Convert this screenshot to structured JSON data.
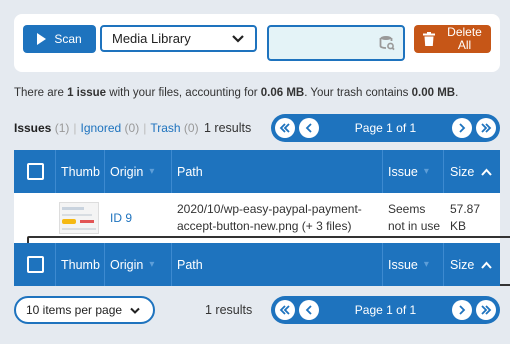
{
  "toolbar": {
    "scan_label": "Scan",
    "source_select": "Media Library",
    "search_placeholder": "",
    "delete_label": "Delete All"
  },
  "summary": {
    "p1": "There are ",
    "issues": "1 issue",
    "p2": " with your files, accounting for ",
    "size": "0.06 MB",
    "p3": ". Your trash contains ",
    "trash_size": "0.00 MB",
    "p4": "."
  },
  "filters": {
    "issues_label": "Issues",
    "issues_count": "(1)",
    "ignored_label": "Ignored",
    "ignored_count": "(0)",
    "trash_label": "Trash",
    "trash_count": "(0)"
  },
  "results_text": "1 results",
  "pagination": {
    "page_text": "Page 1 of 1"
  },
  "table": {
    "columns": {
      "thumb": "Thumb",
      "origin": "Origin",
      "path": "Path",
      "issue": "Issue",
      "size": "Size"
    },
    "rows": [
      {
        "origin": "ID 9",
        "path": "2020/10/wp-easy-paypal-payment-accept-button-new.png (+ 3 files)",
        "issue": "Seems not in use",
        "size": "57.87 KB"
      }
    ]
  },
  "per_page": "10 items per page",
  "colors": {
    "primary": "#1e73be",
    "danger": "#c65617",
    "background": "#e5eaf0"
  }
}
